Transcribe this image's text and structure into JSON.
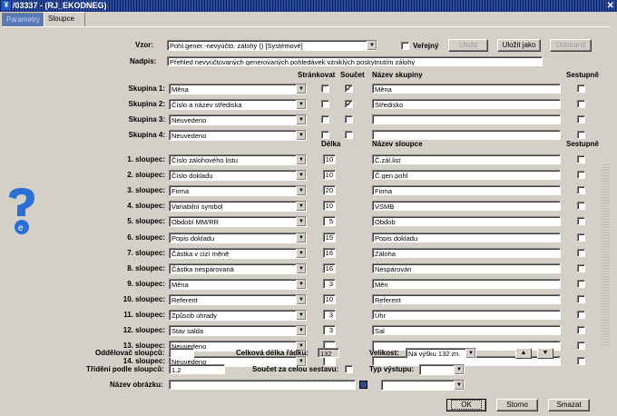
{
  "window": {
    "title": "/03337 - (RJ_EKODNEG)",
    "close_glyph": "✕",
    "logo_glyph": "¥"
  },
  "tabs": [
    "Parametry",
    "Sloupce"
  ],
  "vzor": {
    "label": "Vzor:",
    "value": "Pohl.gener.-nevyúčto. zálohy  ()  [Systémové]",
    "verejny_label": "Veřejný",
    "btn_ulozit": "Uložit",
    "btn_ulozit_jako": "Uložit jako",
    "btn_odstranit": "Odstranit"
  },
  "nadpis": {
    "label": "Nadpis:",
    "value": "Přehled nevyúčtovaných generovaných pohledávek vzniklých poskytnutím zálohy"
  },
  "group_headers": {
    "strankovat": "Stránkovat",
    "soucet": "Součet",
    "nazev_skupiny": "Název skupiny",
    "sestupne": "Sestupně"
  },
  "groups": [
    {
      "label": "Skupina 1:",
      "value": "Měna",
      "strank": false,
      "soucet": true,
      "name": "Měna",
      "sest": false
    },
    {
      "label": "Skupina 2:",
      "value": "Číslo a název střediska",
      "strank": false,
      "soucet": true,
      "name": "Středisko",
      "sest": false
    },
    {
      "label": "Skupina 3:",
      "value": "Neuvedeno",
      "strank": false,
      "soucet": false,
      "name": "",
      "sest": false
    },
    {
      "label": "Skupina 4:",
      "value": "Neuvedeno",
      "strank": false,
      "soucet": false,
      "name": "",
      "sest": false
    }
  ],
  "col_headers": {
    "delka": "Délka",
    "nazev_sloupce": "Název sloupce",
    "sestupne": "Sestupně"
  },
  "columns": [
    {
      "label": "1. sloupec:",
      "value": "Číslo zálohového listu",
      "len": "10",
      "name": "Č.zál.list"
    },
    {
      "label": "2. sloupec:",
      "value": "Číslo dokladu",
      "len": "10",
      "name": "Č.gen.pohl"
    },
    {
      "label": "3. sloupec:",
      "value": "Firma",
      "len": "20",
      "name": "Firma"
    },
    {
      "label": "4. sloupec:",
      "value": "Variabilní symbol",
      "len": "10",
      "name": "VSMB"
    },
    {
      "label": "5. sloupec:",
      "value": "Období MM/RR",
      "len": "5",
      "name": "Obdob"
    },
    {
      "label": "6. sloupec:",
      "value": "Popis dokladu",
      "len": "15",
      "name": "Popis dokladu"
    },
    {
      "label": "7. sloupec:",
      "value": "Částka v cizí měně",
      "len": "16",
      "name": "Záloha"
    },
    {
      "label": "8. sloupec:",
      "value": "Částka nespárovaná",
      "len": "16",
      "name": "Nespárován"
    },
    {
      "label": "9. sloupec:",
      "value": "Měna",
      "len": "3",
      "name": "Měn"
    },
    {
      "label": "10. sloupec:",
      "value": "Referent",
      "len": "10",
      "name": "Referent"
    },
    {
      "label": "11. sloupec:",
      "value": "Způsob úhrady",
      "len": "3",
      "name": "Úhr"
    },
    {
      "label": "12. sloupec:",
      "value": "Stav salda",
      "len": "3",
      "name": "Sal"
    },
    {
      "label": "13. sloupec:",
      "value": "Neuvedeno",
      "len": "",
      "name": ""
    },
    {
      "label": "14. sloupec:",
      "value": "Neuvedeno",
      "len": "",
      "name": ""
    }
  ],
  "bottom": {
    "oddelovac_label": "Oddělovač sloupců:",
    "oddelovac_value": "",
    "celkova_label": "Celková délka řádku:",
    "celkova_value": "132",
    "velikost_label": "Velikost:",
    "velikost_value": "Na výšku 132 zn.",
    "trideni_label": "Třídění podle sloupců:",
    "trideni_value": "1,2",
    "soucet_label": "Součet za celou sestavu:",
    "typ_label": "Typ výstupu:",
    "typ_value": "",
    "obrazek_label": "Název obrázku:",
    "obrazek_value": "",
    "btn_ok": "OK",
    "btn_storno": "Storno",
    "btn_smazat": "Smazat",
    "up_glyph": "▲",
    "down_glyph": "▼",
    "combo_arrow": "▼",
    "check_glyph": "✓"
  },
  "colors": {
    "title_bg": "#0a246a",
    "dialog_bg": "#d4d0c8",
    "help_blue": "#2a6fd6"
  }
}
